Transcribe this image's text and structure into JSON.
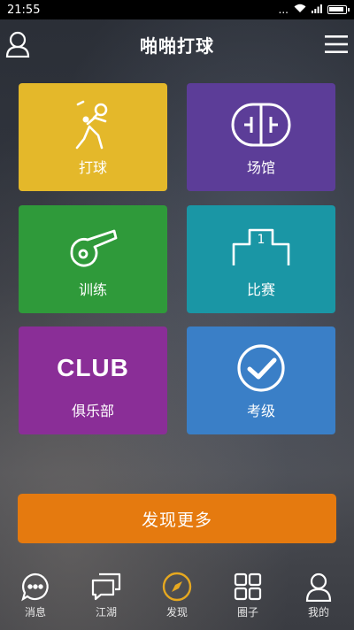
{
  "status_bar": {
    "time": "21:55",
    "signal_text": "...",
    "network": "ull"
  },
  "header": {
    "title": "啪啪打球"
  },
  "tiles": [
    {
      "label": "打球",
      "icon": "badminton-player-icon",
      "color": "#e4b82a"
    },
    {
      "label": "场馆",
      "icon": "court-icon",
      "color": "#5c3d98"
    },
    {
      "label": "训练",
      "icon": "whistle-icon",
      "color": "#2f9a3a"
    },
    {
      "label": "比赛",
      "icon": "podium-icon",
      "color": "#1a96a5",
      "podium_rank": "1"
    },
    {
      "label": "俱乐部",
      "icon": "club-text",
      "color": "#8a2e97",
      "club_text": "CLUB"
    },
    {
      "label": "考级",
      "icon": "check-circle-icon",
      "color": "#3a7fc7"
    }
  ],
  "discover_button": {
    "label": "发现更多",
    "color": "#e57a0f"
  },
  "tabbar": [
    {
      "label": "消息",
      "icon": "chat-bubble-icon"
    },
    {
      "label": "江湖",
      "icon": "chat-stack-icon"
    },
    {
      "label": "发现",
      "icon": "compass-icon",
      "active": true,
      "color": "#e6a820"
    },
    {
      "label": "圈子",
      "icon": "grid-icon"
    },
    {
      "label": "我的",
      "icon": "person-icon"
    }
  ]
}
